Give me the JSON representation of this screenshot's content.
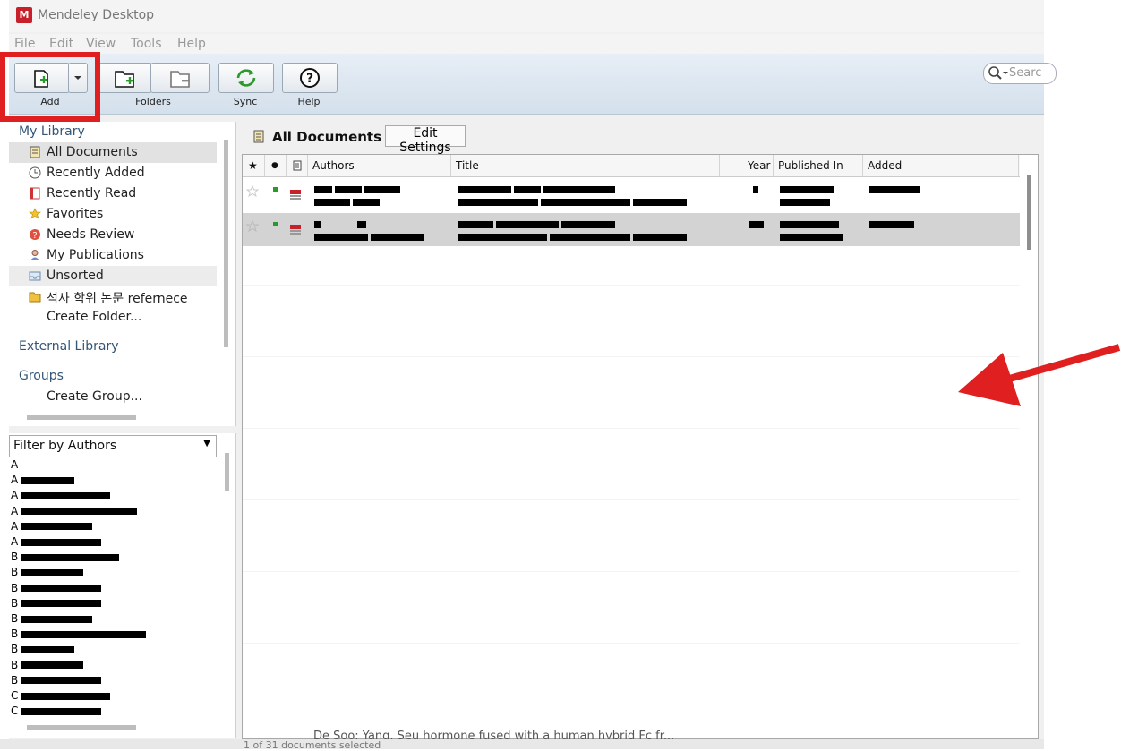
{
  "window": {
    "title": "Mendeley Desktop",
    "logo_text": "M"
  },
  "menu": [
    "File",
    "Edit",
    "View",
    "Tools",
    "Help"
  ],
  "toolbar": {
    "add_label": "Add",
    "folders_label": "Folders",
    "sync_label": "Sync",
    "help_label": "Help",
    "search_placeholder": "Searc"
  },
  "sidebar": {
    "my_library": "My Library",
    "items": [
      {
        "label": "All Documents",
        "icon": "documents-icon"
      },
      {
        "label": "Recently Added",
        "icon": "clock-icon"
      },
      {
        "label": "Recently Read",
        "icon": "book-icon"
      },
      {
        "label": "Favorites",
        "icon": "star-icon"
      },
      {
        "label": "Needs Review",
        "icon": "review-icon"
      },
      {
        "label": "My Publications",
        "icon": "user-icon"
      },
      {
        "label": "Unsorted",
        "icon": "tray-icon"
      },
      {
        "label": "석사 학위 논문 refernece",
        "icon": "folder-icon"
      },
      {
        "label": "Create Folder...",
        "icon": ""
      }
    ],
    "external_library": "External Library",
    "groups": "Groups",
    "create_group": "Create Group..."
  },
  "filter": {
    "label": "Filter by Authors",
    "authors_initials": [
      "A",
      "A",
      "A",
      "A",
      "A",
      "A",
      "B",
      "B",
      "B",
      "B",
      "B",
      "B",
      "B",
      "B",
      "B",
      "C",
      "C"
    ]
  },
  "main": {
    "title": "All Documents",
    "edit_settings": "Edit Settings",
    "columns": [
      "Authors",
      "Title",
      "Year",
      "Published In",
      "Added"
    ],
    "bottom_row_text": "De Soo; Yang, Seu          hormone fused with a human hybrid Fc fr..."
  },
  "status": {
    "text": "1 of 31 documents selected"
  },
  "colors": {
    "accent_red": "#e02020",
    "toolbar_top": "#e7eef6",
    "selection": "#d3d3d3"
  }
}
